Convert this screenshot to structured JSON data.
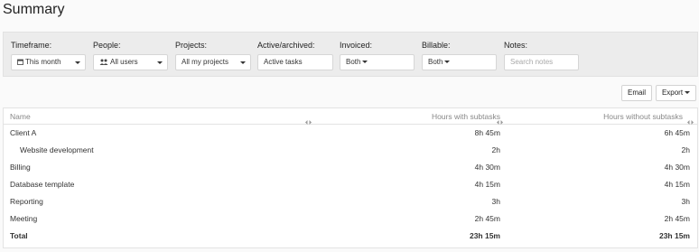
{
  "page": {
    "title": "Summary"
  },
  "filters": {
    "timeframe": {
      "label": "Timeframe:",
      "value": "This month"
    },
    "people": {
      "label": "People:",
      "value": "All users"
    },
    "projects": {
      "label": "Projects:",
      "value": "All my projects"
    },
    "active": {
      "label": "Active/archived:",
      "value": "Active tasks"
    },
    "invoiced": {
      "label": "Invoiced:",
      "value": "Both"
    },
    "billable": {
      "label": "Billable:",
      "value": "Both"
    },
    "notes": {
      "label": "Notes:",
      "placeholder": "Search notes"
    }
  },
  "actions": {
    "email": "Email",
    "export": "Export"
  },
  "table": {
    "columns": {
      "name": "Name",
      "with": "Hours with subtasks",
      "without": "Hours without subtasks"
    },
    "rows": [
      {
        "name": "Client A",
        "with": "8h 45m",
        "without": "6h 45m"
      },
      {
        "name": "Website development",
        "with": "2h",
        "without": "2h"
      },
      {
        "name": "Billing",
        "with": "4h 30m",
        "without": "4h 30m"
      },
      {
        "name": "Database template",
        "with": "4h 15m",
        "without": "4h 15m"
      },
      {
        "name": "Reporting",
        "with": "3h",
        "without": "3h"
      },
      {
        "name": "Meeting",
        "with": "2h 45m",
        "without": "2h 45m"
      }
    ],
    "total": {
      "name": "Total",
      "with": "23h 15m",
      "without": "23h 15m"
    }
  }
}
